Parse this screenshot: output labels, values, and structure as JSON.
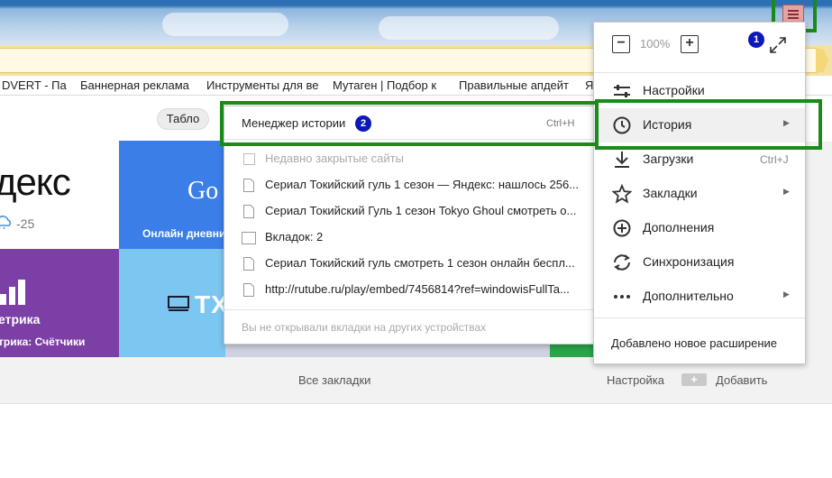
{
  "bookmarks_bar": [
    {
      "label": "DVERT - Пар"
    },
    {
      "label": "Баннерная реклама"
    },
    {
      "label": "Инструменты для ве"
    },
    {
      "label": "Мутаген | Подбор к"
    },
    {
      "label": "Правильные апдейт"
    },
    {
      "label": "Я"
    }
  ],
  "tablo": {
    "pill_label": "Табло"
  },
  "tiles": {
    "yandex": {
      "title": "декс",
      "temp": "-25"
    },
    "google": {
      "title": "Go",
      "subtitle": "Онлайн дневни"
    },
    "metrika": {
      "title": "етрика",
      "subtitle": "трика: Счётчики"
    },
    "tx": {
      "title": "TX"
    }
  },
  "footer": {
    "all_bookmarks": "Все закладки",
    "settings": "Настройка",
    "add": "Добавить"
  },
  "history_submenu": {
    "header": {
      "label": "Менеджер истории",
      "shortcut": "Ctrl+H",
      "badge": "2"
    },
    "recently_closed": "Недавно закрытые сайты",
    "items": [
      {
        "label": "Сериал Токийский гуль 1 сезон — Яндекс: нашлось 256..."
      },
      {
        "label": "Сериал Токийский Гуль 1 сезон Tokyo Ghoul смотреть о..."
      },
      {
        "label": "Вкладок: 2"
      },
      {
        "label": "Сериал Токийский гуль смотреть 1 сезон онлайн беспл..."
      },
      {
        "label": "http://rutube.ru/play/embed/7456814?ref=windowisFullTa..."
      }
    ],
    "other_devices": "Вы не открывали вкладки на других устройствах"
  },
  "main_menu": {
    "zoom": {
      "minus": "−",
      "value": "100%",
      "plus": "+",
      "badge": "1"
    },
    "items": [
      {
        "label": "Настройки",
        "icon": "settings-sliders-icon"
      },
      {
        "label": "История",
        "icon": "clock-icon",
        "has_submenu": true
      },
      {
        "label": "Загрузки",
        "icon": "download-icon",
        "shortcut": "Ctrl+J"
      },
      {
        "label": "Закладки",
        "icon": "star-icon",
        "has_submenu": true
      },
      {
        "label": "Дополнения",
        "icon": "plus-circle-icon"
      },
      {
        "label": "Синхронизация",
        "icon": "sync-icon"
      },
      {
        "label": "Дополнительно",
        "icon": "more-dots-icon",
        "has_submenu": true
      }
    ],
    "footer_note": "Добавлено новое расширение"
  },
  "colors": {
    "highlight": "#1a8a1a",
    "badge": "#0c18b8",
    "yandex_bar": "#f3e2a4"
  }
}
